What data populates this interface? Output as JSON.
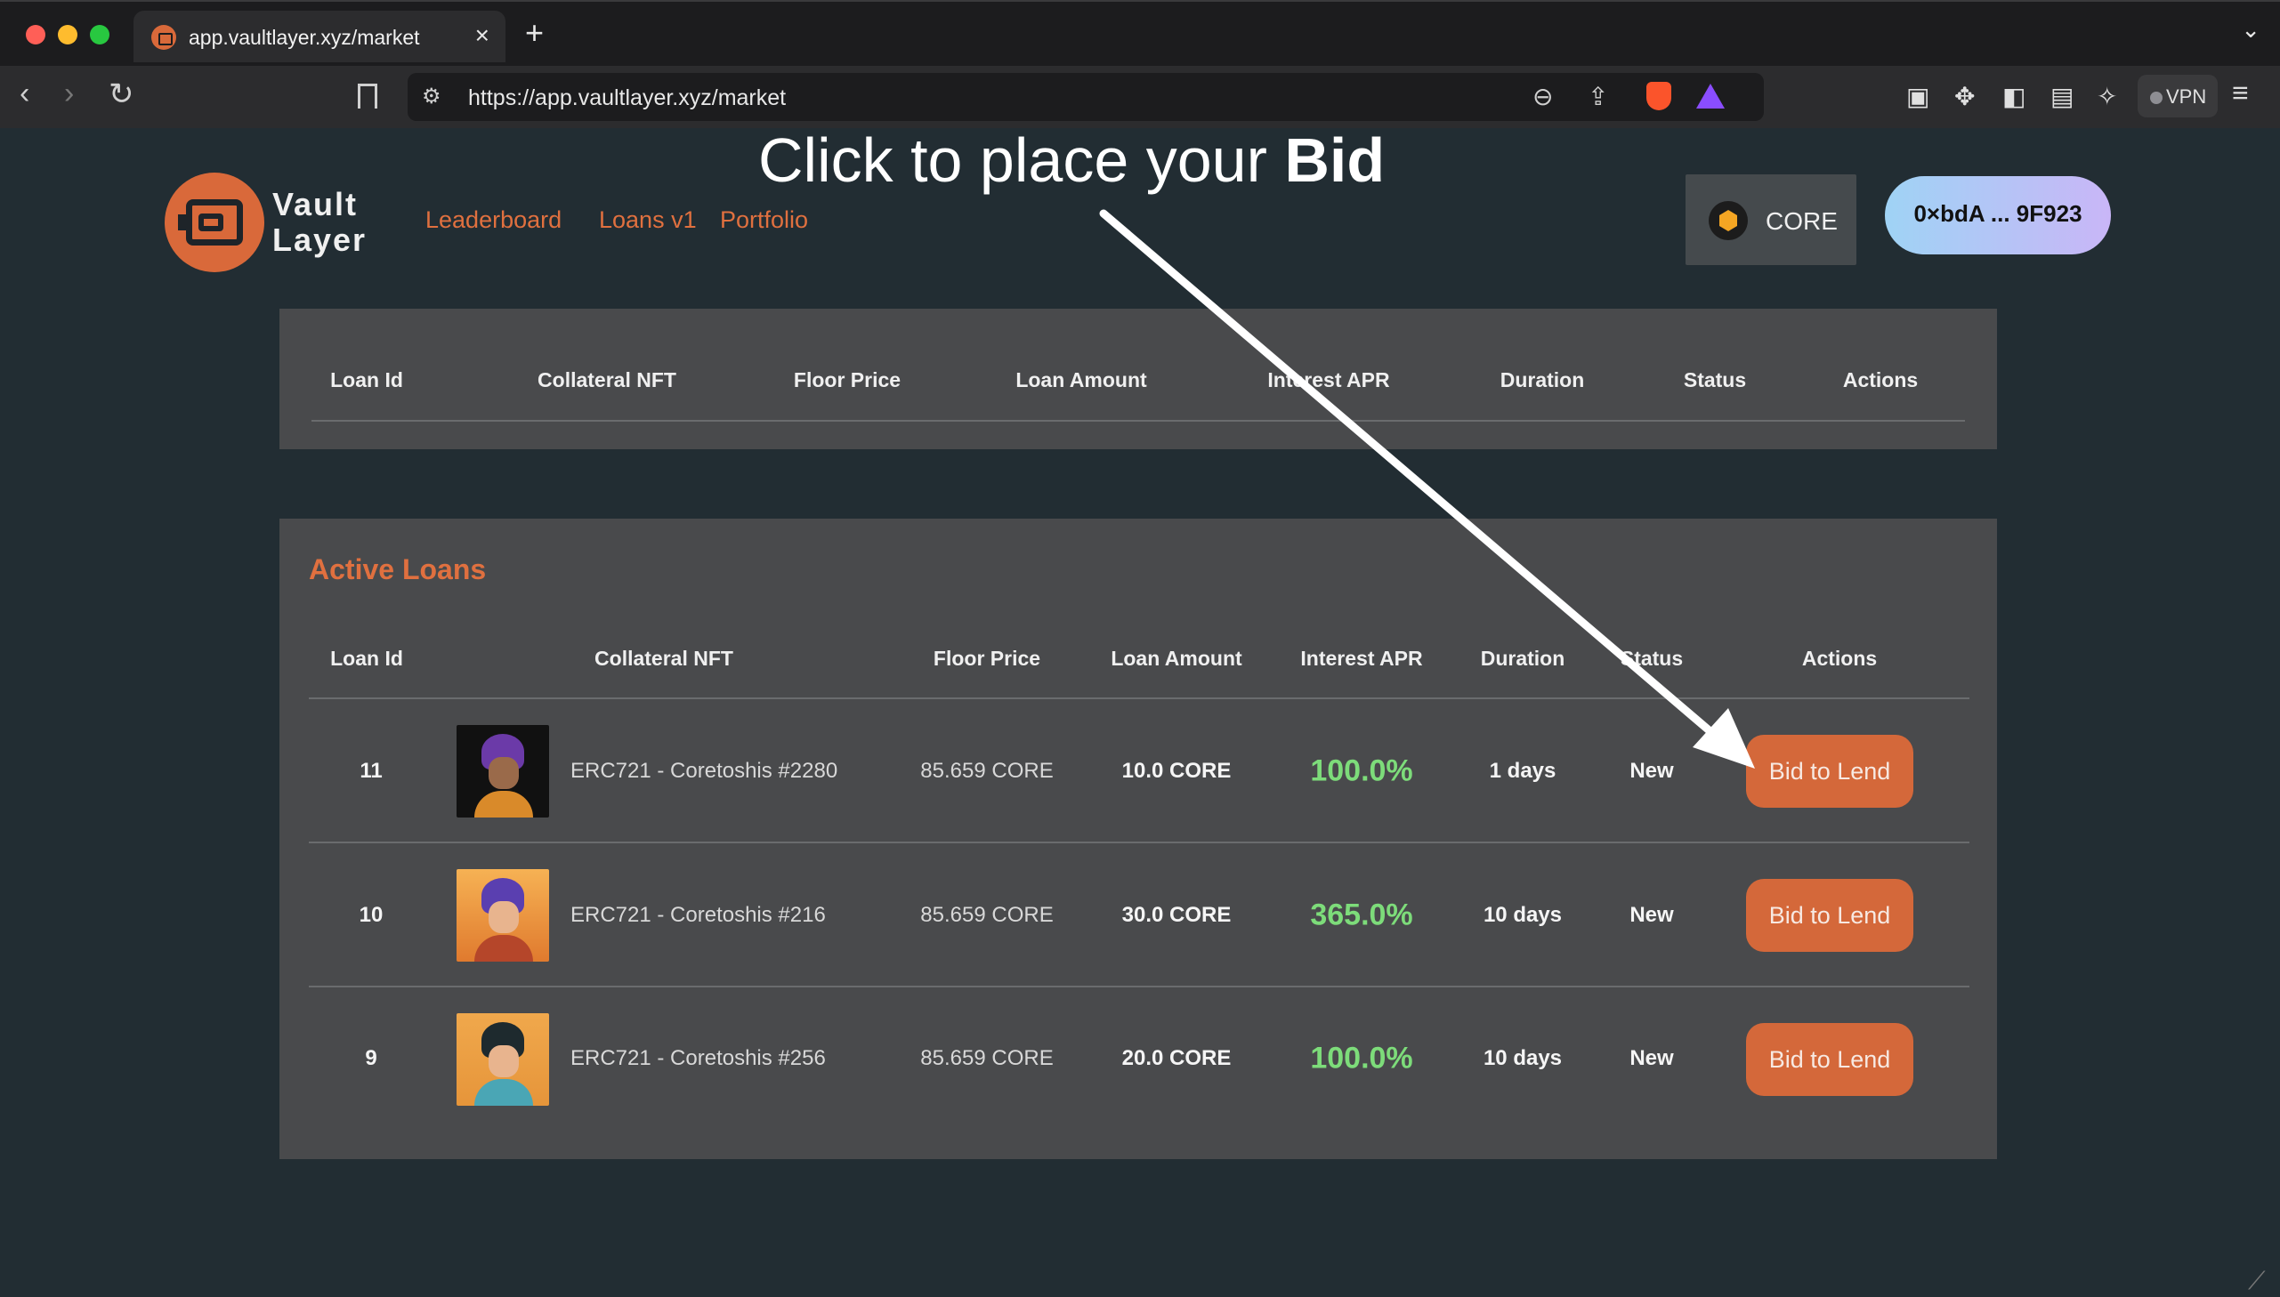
{
  "browser": {
    "tab_title": "app.vaultlayer.xyz/market",
    "tab_close": "×",
    "new_tab": "+",
    "tab_menu": "⌄",
    "url": "https://app.vaultlayer.xyz/market",
    "vpn_label": "VPN"
  },
  "header": {
    "logo_line1": "Vault",
    "logo_line2": "Layer",
    "nav": [
      "Leaderboard",
      "Loans v1",
      "Portfolio"
    ],
    "chain_label": "CORE",
    "wallet_address": "0×bdA ... 9F923"
  },
  "annotation": {
    "text_prefix": "Click to place your ",
    "text_bold": "Bid"
  },
  "top_table": {
    "headers": [
      "Loan Id",
      "Collateral NFT",
      "Floor Price",
      "Loan Amount",
      "Interest APR",
      "Duration",
      "Status",
      "Actions"
    ]
  },
  "active_loans": {
    "title": "Active Loans",
    "headers": [
      "Loan Id",
      "Collateral NFT",
      "Floor Price",
      "Loan Amount",
      "Interest APR",
      "Duration",
      "Status",
      "Actions"
    ],
    "rows": [
      {
        "id": "11",
        "nft": "ERC721 - Coretoshis #2280",
        "floor": "85.659 CORE",
        "amount": "10.0 CORE",
        "apr": "100.0%",
        "duration": "1 days",
        "status": "New",
        "action": "Bid to Lend"
      },
      {
        "id": "10",
        "nft": "ERC721 - Coretoshis #216",
        "floor": "85.659 CORE",
        "amount": "30.0 CORE",
        "apr": "365.0%",
        "duration": "10 days",
        "status": "New",
        "action": "Bid to Lend"
      },
      {
        "id": "9",
        "nft": "ERC721 - Coretoshis #256",
        "floor": "85.659 CORE",
        "amount": "20.0 CORE",
        "apr": "100.0%",
        "duration": "10 days",
        "status": "New",
        "action": "Bid to Lend"
      }
    ]
  },
  "colors": {
    "accent": "#e0703f",
    "button": "#d4683a",
    "apr_green": "#7ddc7a",
    "page_bg": "#222d33",
    "panel_bg": "#494a4c"
  }
}
